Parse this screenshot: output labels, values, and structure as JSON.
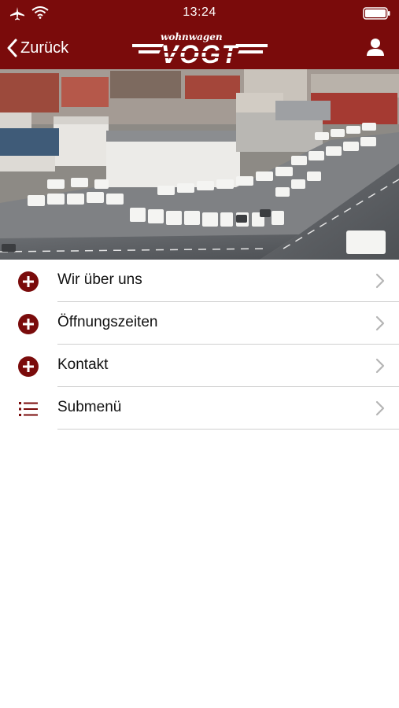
{
  "status_bar": {
    "time": "13:24"
  },
  "nav": {
    "back_label": "Zurück",
    "logo_small": "wohnwagen",
    "logo_big": "VOGT"
  },
  "menu": {
    "items": [
      {
        "label": "Wir über uns",
        "icon": "plus-circle-icon"
      },
      {
        "label": "Öffnungszeiten",
        "icon": "plus-circle-icon"
      },
      {
        "label": "Kontakt",
        "icon": "plus-circle-icon"
      },
      {
        "label": "Submenü",
        "icon": "list-icon"
      }
    ]
  },
  "colors": {
    "brand": "#7a0b0b",
    "separator": "#cfcfcf",
    "chevron": "#b5b5b5"
  }
}
